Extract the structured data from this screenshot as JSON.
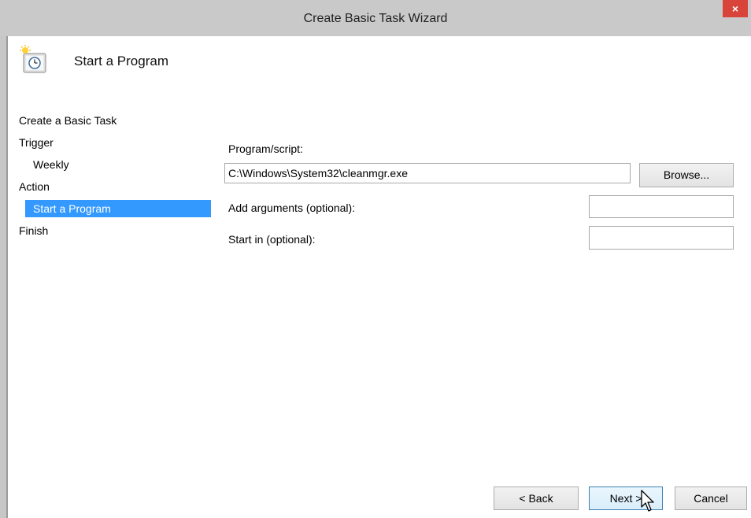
{
  "window": {
    "title": "Create Basic Task Wizard",
    "close_label": "×"
  },
  "header": {
    "title": "Start a Program",
    "icon": "task-scheduler-clock-icon"
  },
  "nav": {
    "items": [
      {
        "label": "Create a Basic Task",
        "level": 0,
        "selected": false
      },
      {
        "label": "Trigger",
        "level": 0,
        "selected": false
      },
      {
        "label": "Weekly",
        "level": 1,
        "selected": false
      },
      {
        "label": "Action",
        "level": 0,
        "selected": false
      },
      {
        "label": "Start a Program",
        "level": 1,
        "selected": true
      },
      {
        "label": "Finish",
        "level": 0,
        "selected": false
      }
    ]
  },
  "form": {
    "program_label": "Program/script:",
    "program_value": "C:\\Windows\\System32\\cleanmgr.exe",
    "browse_label": "Browse...",
    "arguments_label": "Add arguments (optional):",
    "arguments_value": "",
    "start_in_label": "Start in (optional):",
    "start_in_value": ""
  },
  "footer": {
    "back_label": "< Back",
    "next_label": "Next >",
    "cancel_label": "Cancel"
  },
  "colors": {
    "selection": "#3399ff",
    "close_button": "#d9443a",
    "title_bar": "#c9c9c9"
  }
}
